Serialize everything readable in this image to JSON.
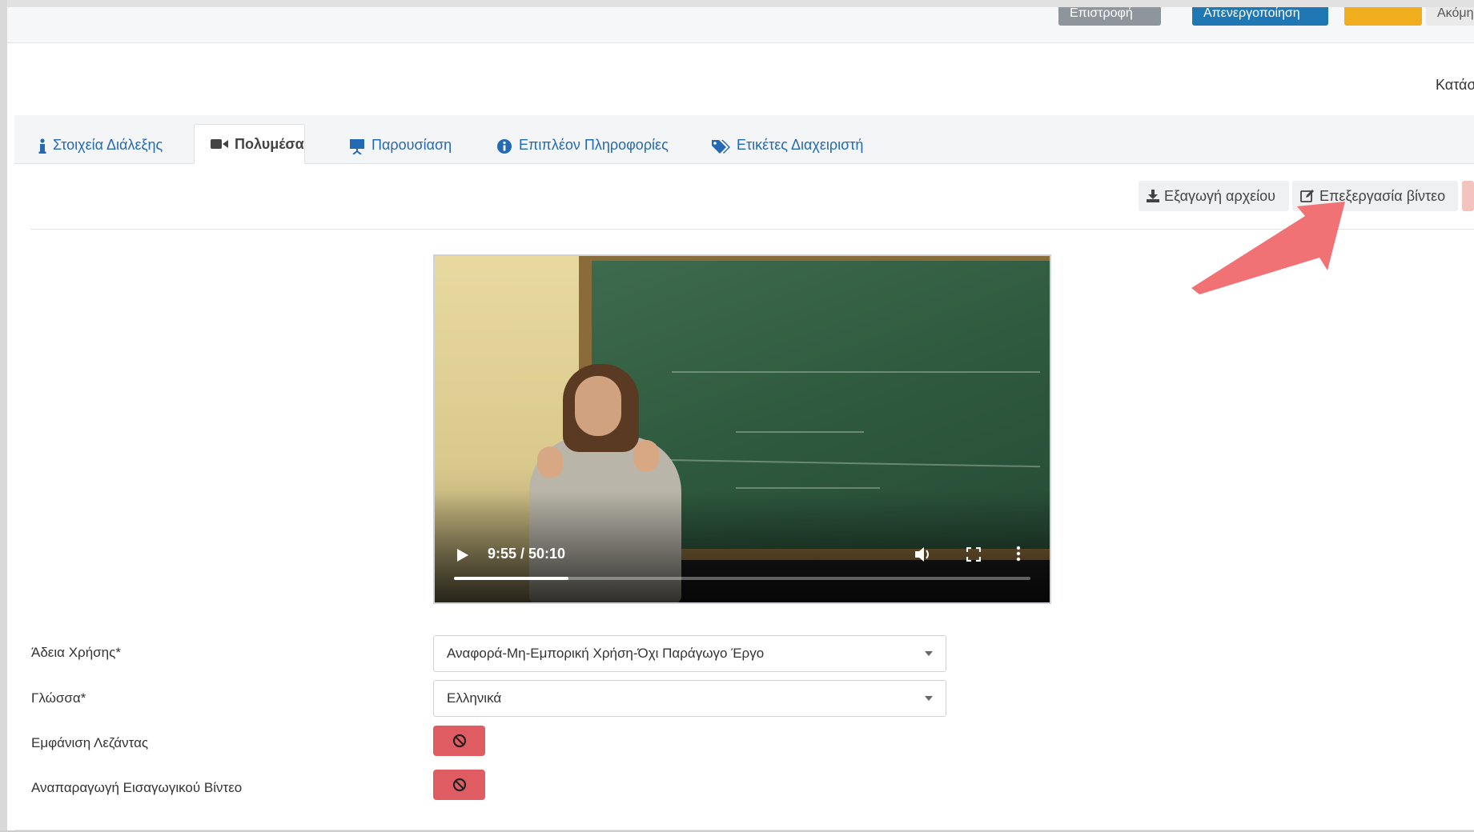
{
  "top_actions": {
    "back_label": "Επιστροφή",
    "activate_label": "Απενεργοποίηση",
    "more_label": "Ακόμη"
  },
  "subtitle": "Κατάσταση",
  "tabs": [
    {
      "label": "Στοιχεία Διάλεξης",
      "icon": "info-icon"
    },
    {
      "label": "Πολυμέσα",
      "icon": "video-camera-icon",
      "active": true
    },
    {
      "label": "Παρουσίαση",
      "icon": "presentation-icon"
    },
    {
      "label": "Επιπλέον Πληροφορίες",
      "icon": "info-circle-icon"
    },
    {
      "label": "Ετικέτες Διαχειριστή",
      "icon": "tags-icon"
    }
  ],
  "toolbar": {
    "export_label": "Εξαγωγή αρχείου",
    "edit_video_label": "Επεξεργασία βίντεο"
  },
  "video": {
    "current_time": "9:55",
    "duration": "50:10",
    "time_display": "9:55 / 50:10",
    "progress_fraction": 0.198
  },
  "form": {
    "license_label": "Άδεια Χρήσης*",
    "license_value": "Αναφορά-Μη-Εμπορική Χρήση-Όχι Παράγωγο Έργο",
    "language_label": "Γλώσσα*",
    "language_value": "Ελληνικά",
    "captions_label": "Εμφάνιση Λεζάντας",
    "intro_video_label": "Αναπαραγωγή Εισαγωγικού Βίντεο"
  },
  "colors": {
    "link_blue": "#2469b3",
    "toggle_off_red": "#e05c63",
    "annotation_arrow": "#f06a6e"
  }
}
